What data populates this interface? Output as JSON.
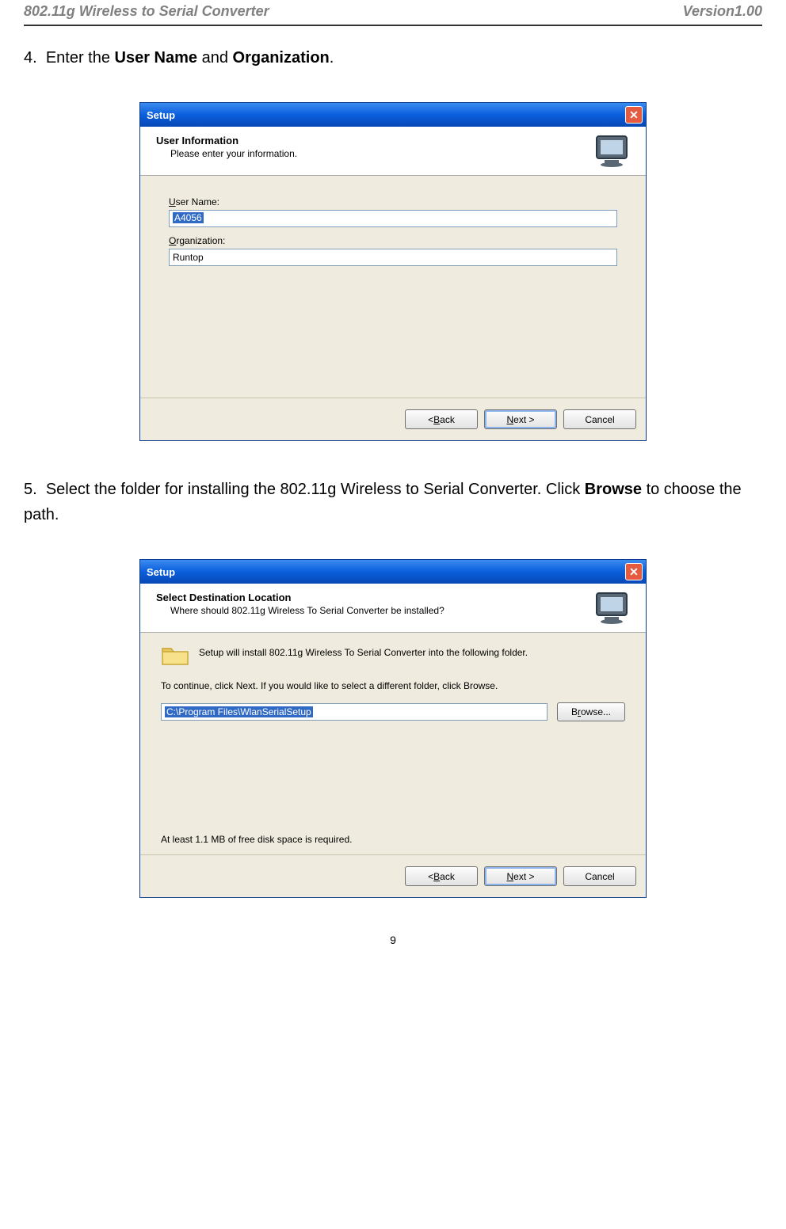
{
  "header": {
    "left": "802.11g Wireless to Serial Converter",
    "right": "Version1.00"
  },
  "step4": {
    "num": "4.",
    "text_before": "Enter the ",
    "bold1": "User Name",
    "mid": " and ",
    "bold2": "Organization",
    "after": "."
  },
  "dlg1": {
    "title": "Setup",
    "hdr_title": "User Information",
    "hdr_sub": "Please enter your information.",
    "user_label_u": "U",
    "user_label_rest": "ser Name:",
    "user_value": "A4056",
    "org_label_u": "O",
    "org_label_rest": "rganization:",
    "org_value": "Runtop",
    "back_u": "B",
    "back_rest": "ack",
    "back_prefix": "< ",
    "next_u": "N",
    "next_rest": "ext >",
    "cancel": "Cancel"
  },
  "step5": {
    "num": "5.",
    "text": "Select the folder for installing the 802.11g Wireless to Serial Converter. Click ",
    "bold": "Browse",
    "after": " to choose the path."
  },
  "dlg2": {
    "title": "Setup",
    "hdr_title": "Select Destination Location",
    "hdr_sub": "Where should 802.11g Wireless To Serial Converter be installed?",
    "install_text": "Setup will install 802.11g Wireless To Serial Converter into the following folder.",
    "continue_text": "To continue, click Next. If you would like to select a different folder, click Browse.",
    "path": "C:\\Program Files\\WlanSerialSetup",
    "browse_u": "r",
    "browse_before": "B",
    "browse_after": "owse...",
    "diskspace": "At least 1.1 MB of free disk space is required.",
    "back_u": "B",
    "back_rest": "ack",
    "back_prefix": "< ",
    "next_u": "N",
    "next_rest": "ext >",
    "cancel": "Cancel"
  },
  "pagenum": "9"
}
